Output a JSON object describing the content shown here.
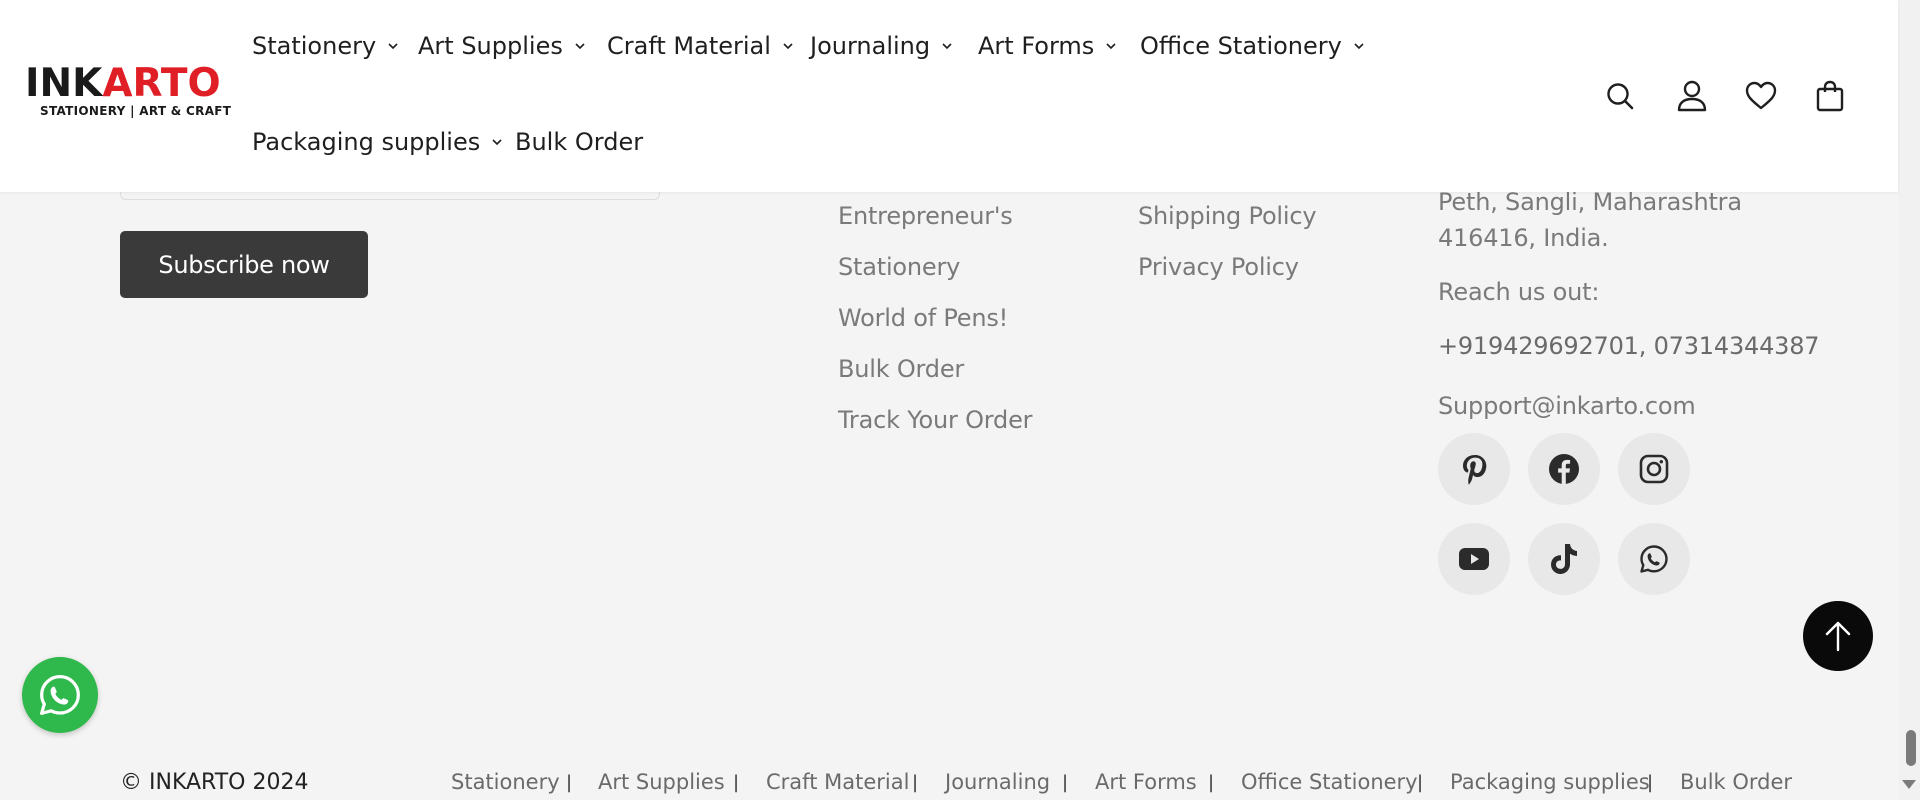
{
  "header": {
    "logo": {
      "main_prefix": "INK",
      "main_accent": "ARTO",
      "tagline": "STATIONERY | ART & CRAFT"
    },
    "nav": [
      {
        "label": "Stationery",
        "has_dropdown": true
      },
      {
        "label": "Art Supplies",
        "has_dropdown": true
      },
      {
        "label": "Craft Material",
        "has_dropdown": true
      },
      {
        "label": "Journaling",
        "has_dropdown": true
      },
      {
        "label": "Art Forms",
        "has_dropdown": true
      },
      {
        "label": "Office Stationery",
        "has_dropdown": true
      },
      {
        "label": "Packaging supplies",
        "has_dropdown": true
      },
      {
        "label": "Bulk Order",
        "has_dropdown": false
      }
    ],
    "icons": [
      "search-icon",
      "account-icon",
      "wishlist-heart-icon",
      "cart-bag-icon"
    ]
  },
  "newsletter": {
    "button_label": "Subscribe now"
  },
  "footer": {
    "links_col1": [
      "Entrepreneur's",
      "Stationery",
      "World of Pens!",
      "Bulk Order",
      "Track Your Order"
    ],
    "links_col2": [
      "Shipping Policy",
      "Privacy Policy"
    ],
    "contact": {
      "address_line1": "Peth, Sangli, Maharashtra",
      "address_line2": "416416, India.",
      "reach_label": "Reach us out:",
      "phones": "+919429692701, 07314344387",
      "email": "Support@inkarto.com"
    },
    "social": [
      "pinterest-icon",
      "facebook-icon",
      "instagram-icon",
      "youtube-icon",
      "tiktok-icon",
      "whatsapp-icon"
    ]
  },
  "bottom_bar": {
    "copyright": "© INKARTO 2024",
    "links": [
      "Stationery",
      "Art Supplies",
      "Craft Material",
      "Journaling",
      "Art Forms",
      "Office Stationery",
      "Packaging supplies",
      "Bulk Order"
    ],
    "separator": "|"
  },
  "colors": {
    "logo_accent": "#e01e26",
    "button_dark": "#3a3a3a",
    "whatsapp_green": "#2fb84b",
    "footer_bg": "#f4f4f4"
  }
}
